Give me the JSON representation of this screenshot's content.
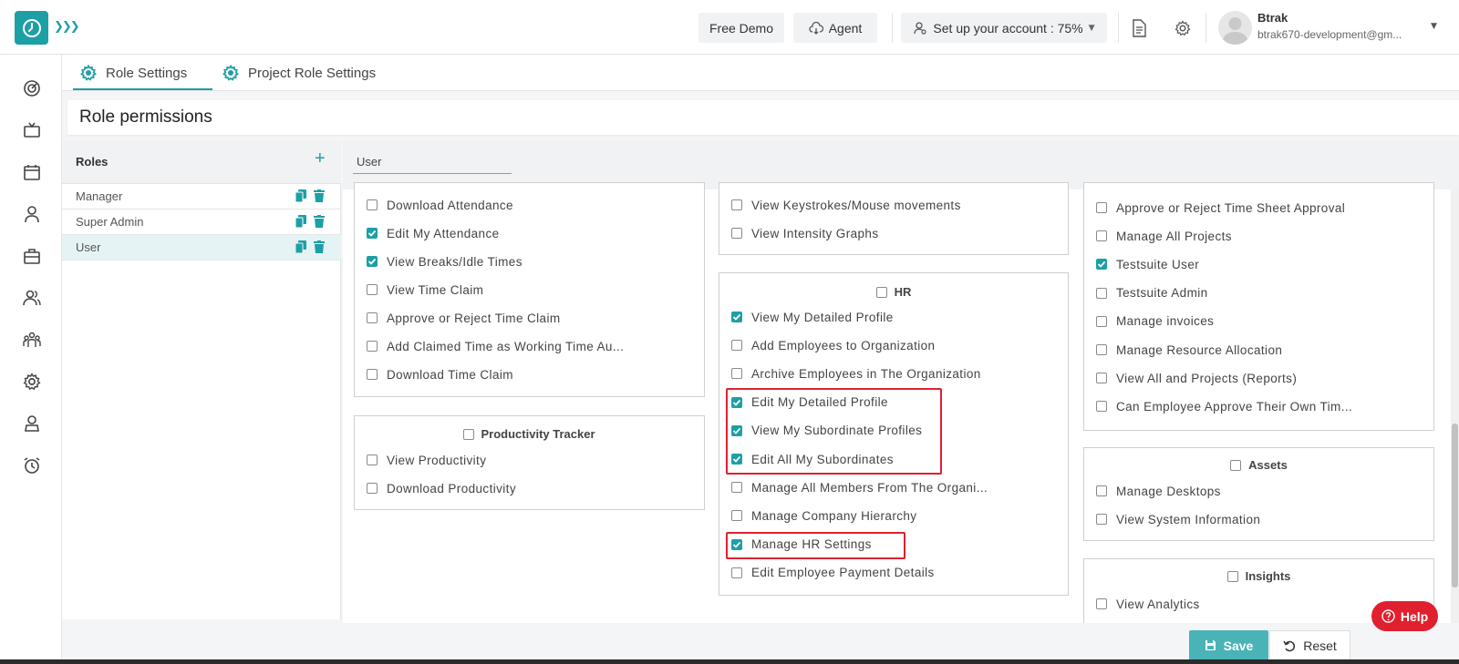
{
  "header": {
    "free_demo": "Free Demo",
    "agent": "Agent",
    "setup": "Set up your account : 75%",
    "user_name": "Btrak",
    "user_email": "btrak670-development@gm..."
  },
  "tabs": [
    {
      "label": "Role Settings"
    },
    {
      "label": "Project Role Settings"
    }
  ],
  "page_title": "Role permissions",
  "roles": {
    "title": "Roles",
    "items": [
      {
        "label": "Manager"
      },
      {
        "label": "Super Admin"
      },
      {
        "label": "User"
      }
    ]
  },
  "selected_role": "User",
  "col1": {
    "top_items": [
      {
        "label": "Download Attendance",
        "checked": false
      },
      {
        "label": "Edit My Attendance",
        "checked": true
      },
      {
        "label": "View Breaks/Idle Times",
        "checked": true
      },
      {
        "label": "View Time Claim",
        "checked": false
      },
      {
        "label": "Approve or Reject Time Claim",
        "checked": false
      },
      {
        "label": "Add Claimed Time as Working Time Au...",
        "checked": false
      },
      {
        "label": "Download Time Claim",
        "checked": false
      }
    ],
    "productivity": {
      "title": "Productivity Tracker",
      "items": [
        {
          "label": "View Productivity",
          "checked": false
        },
        {
          "label": "Download Productivity",
          "checked": false
        }
      ]
    }
  },
  "col2": {
    "top_items": [
      {
        "label": "View Keystrokes/Mouse movements",
        "checked": false
      },
      {
        "label": "View Intensity Graphs",
        "checked": false
      }
    ],
    "hr": {
      "title": "HR",
      "items": [
        {
          "label": "View My Detailed Profile",
          "checked": true
        },
        {
          "label": "Add Employees to Organization",
          "checked": false
        },
        {
          "label": "Archive Employees in The Organization",
          "checked": false
        },
        {
          "label": "Edit My Detailed Profile",
          "checked": true
        },
        {
          "label": "View My Subordinate Profiles",
          "checked": true
        },
        {
          "label": "Edit All My Subordinates",
          "checked": true
        },
        {
          "label": "Manage All Members From The Organi...",
          "checked": false
        },
        {
          "label": "Manage Company Hierarchy",
          "checked": false
        },
        {
          "label": "Manage HR Settings",
          "checked": true
        },
        {
          "label": "Edit Employee Payment Details",
          "checked": false
        }
      ]
    }
  },
  "col3": {
    "top_items": [
      {
        "label": "Approve or Reject Time Sheet Approval",
        "checked": false
      },
      {
        "label": "Manage All Projects",
        "checked": false
      },
      {
        "label": "Testsuite User",
        "checked": true
      },
      {
        "label": "Testsuite Admin",
        "checked": false
      },
      {
        "label": "Manage invoices",
        "checked": false
      },
      {
        "label": "Manage Resource Allocation",
        "checked": false
      },
      {
        "label": "View All and Projects (Reports)",
        "checked": false
      },
      {
        "label": "Can Employee Approve Their Own Tim...",
        "checked": false
      }
    ],
    "assets": {
      "title": "Assets",
      "items": [
        {
          "label": "Manage Desktops",
          "checked": false
        },
        {
          "label": "View System Information",
          "checked": false
        }
      ]
    },
    "insights": {
      "title": "Insights",
      "items": [
        {
          "label": "View Analytics",
          "checked": false
        }
      ]
    }
  },
  "footer": {
    "save": "Save",
    "reset": "Reset",
    "help": "Help"
  },
  "colors": {
    "accent": "#1d9fa6",
    "highlight": "#e0202f"
  }
}
